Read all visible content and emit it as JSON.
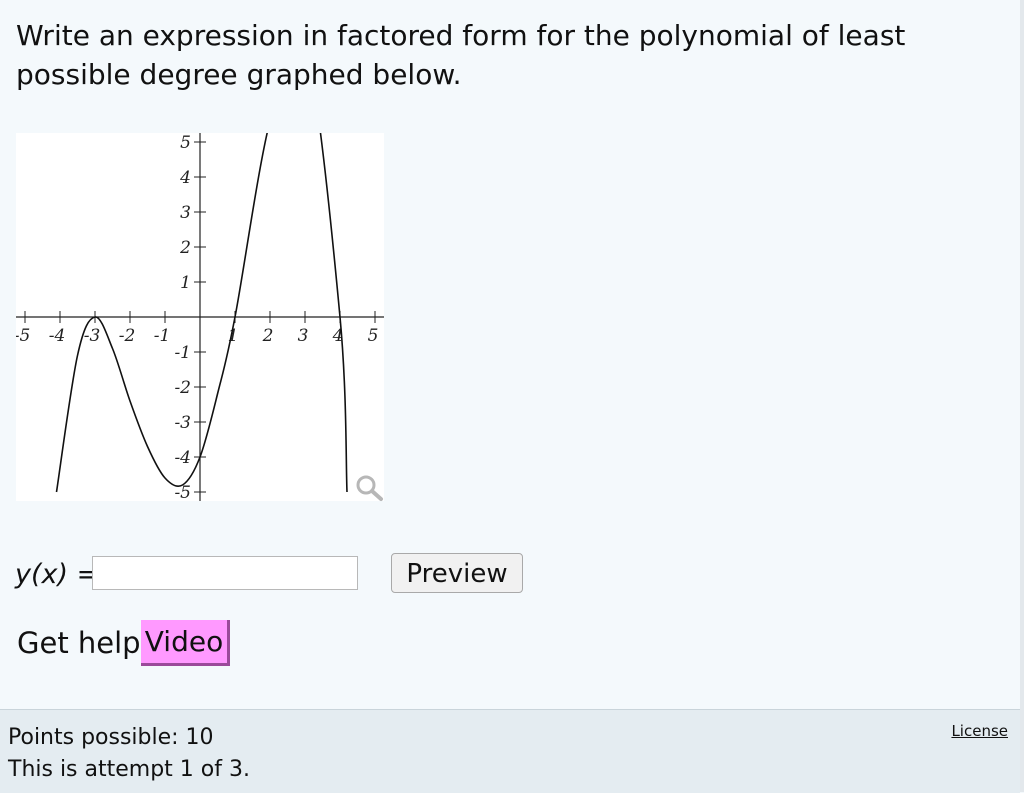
{
  "question": {
    "text": "Write an expression in factored form for the polynomial of least possible degree graphed below."
  },
  "graph": {
    "x_tick_labels": [
      "-5",
      "-4",
      "-3",
      "-2",
      "-1",
      "1",
      "2",
      "3",
      "4",
      "5"
    ],
    "y_tick_labels": [
      "5",
      "4",
      "3",
      "2",
      "1",
      "-1",
      "-2",
      "-3",
      "-4",
      "-5"
    ],
    "x_ticks": [
      -5,
      -4,
      -3,
      -2,
      -1,
      1,
      2,
      3,
      4,
      5
    ],
    "y_ticks": [
      5,
      4,
      3,
      2,
      1,
      -1,
      -2,
      -3,
      -4,
      -5
    ],
    "magnify_icon": "magnifying-glass-icon"
  },
  "chart_data": {
    "type": "line",
    "xlim": [
      -5,
      5
    ],
    "ylim": [
      -5,
      5
    ],
    "grid": false,
    "series": [
      {
        "x": [
          -4.1,
          -3.5,
          -3,
          -2.5,
          -2,
          -1.5,
          -1,
          -0.5,
          0,
          0.5,
          1,
          2,
          3,
          4,
          4.2
        ],
        "y": [
          -5,
          -1.1,
          0,
          -0.9,
          -2.4,
          -3.7,
          -4.6,
          -4.8,
          -4,
          -2.2,
          0,
          5.6,
          7.8,
          0,
          -5
        ]
      }
    ]
  },
  "answer": {
    "label_var": "y(x)",
    "label_eq": " =",
    "value": "",
    "placeholder": ""
  },
  "buttons": {
    "preview": "Preview"
  },
  "help": {
    "label": "Get help:",
    "video": "Video"
  },
  "footer": {
    "points": "Points possible: 10",
    "attempt": "This is attempt 1 of 3.",
    "license": "License"
  }
}
